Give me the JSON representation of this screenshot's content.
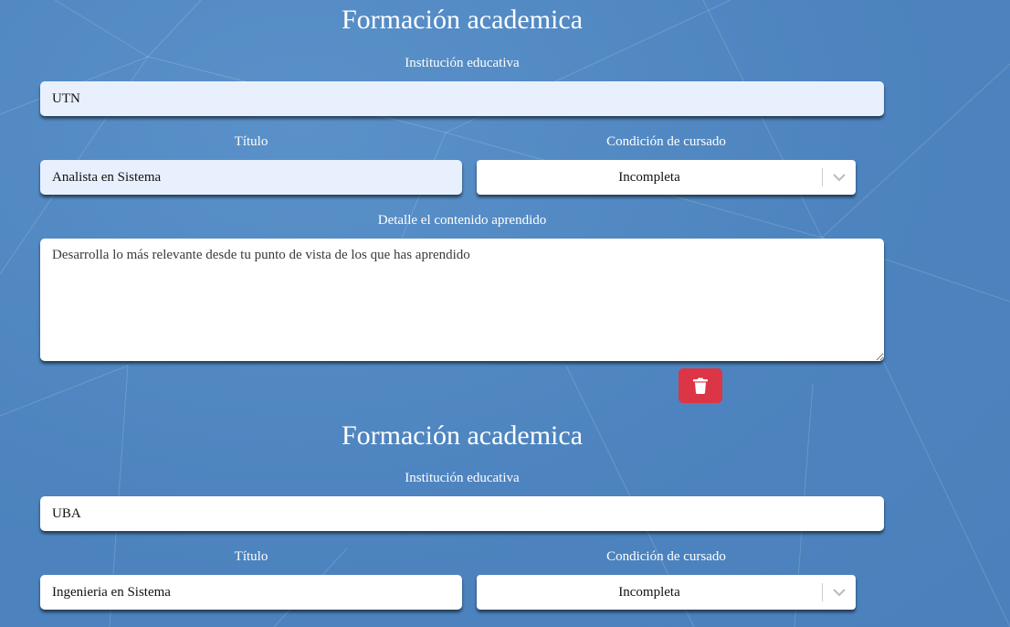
{
  "sections": [
    {
      "title": "Formación academica",
      "institution_label": "Institución educativa",
      "institution_value": "UTN",
      "degree_label": "Título",
      "degree_value": "Analista en Sistema",
      "status_label": "Condición de cursado",
      "status_value": "Incompleta",
      "details_label": "Detalle el contenido aprendido",
      "details_placeholder": "Desarrolla lo más relevante desde tu punto de vista de los que has aprendido",
      "delete_icon": "trash-icon"
    },
    {
      "title": "Formación academica",
      "institution_label": "Institución educativa",
      "institution_value": "UBA",
      "degree_label": "Título",
      "degree_value": "Ingenieria en Sistema",
      "status_label": "Condición de cursado",
      "status_value": "Incompleta"
    }
  ],
  "colors": {
    "background": "#4f86c0",
    "autofill": "#e8f0fe",
    "delete": "#dc3545"
  }
}
